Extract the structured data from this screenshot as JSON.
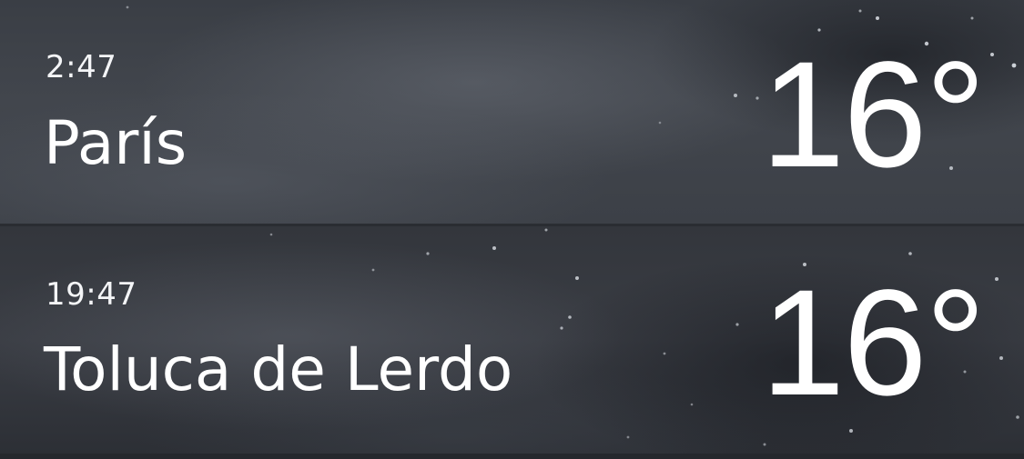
{
  "locations": [
    {
      "time": "2:47",
      "city": "París",
      "temperature": "16°"
    },
    {
      "time": "19:47",
      "city": "Toluca de Lerdo",
      "temperature": "16°"
    }
  ]
}
